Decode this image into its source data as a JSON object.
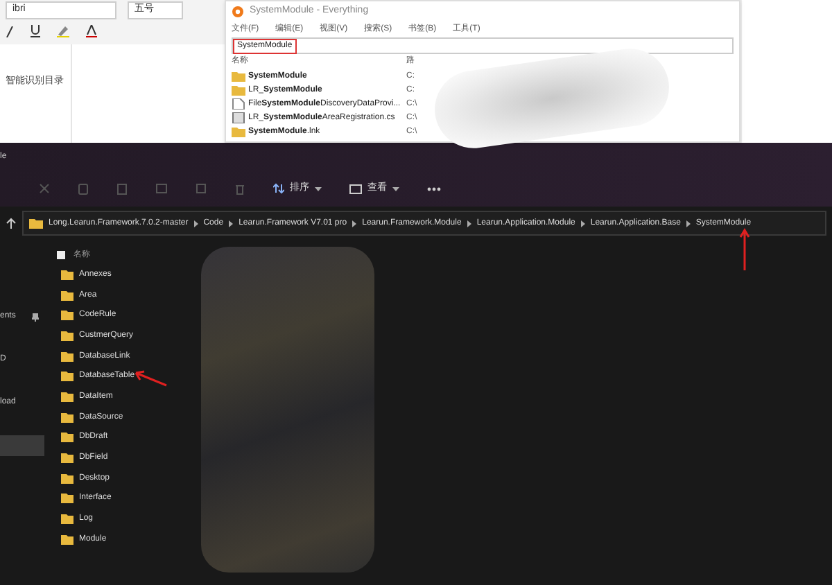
{
  "word_toolbar": {
    "font_name": "ibri",
    "font_size": "五号"
  },
  "word_nav_pane": {
    "title": "智能识别目录"
  },
  "everything_window": {
    "title": "SystemModule - Everything",
    "menu": [
      "文件(F)",
      "编辑(E)",
      "视图(V)",
      "搜索(S)",
      "书签(B)",
      "工具(T)"
    ],
    "search": {
      "value": "SystemModule"
    },
    "columns": [
      "名称",
      "路"
    ],
    "rows": [
      {
        "kind": "folder",
        "name": "**SystemModule**",
        "path": "C:"
      },
      {
        "kind": "folder",
        "name": "LR_**SystemModule**",
        "path": "C:"
      },
      {
        "kind": "file",
        "name": "File**SystemModule**DiscoveryDataProvi...",
        "path": "C:\\"
      },
      {
        "kind": "code",
        "name": "LR_**SystemModule**AreaRegistration.cs",
        "path": "C:\\"
      },
      {
        "kind": "folder",
        "name": "**SystemModule**.lnk",
        "path": "C:\\"
      }
    ]
  },
  "explorer": {
    "title": "le",
    "toolbar": [
      "排序",
      "查看"
    ],
    "breadcrumbs": [
      "Long.Learun.Framework.7.0.2-master",
      "Code",
      "Learun.Framework V7.01 pro",
      "Learun.Framework.Module",
      "Learun.Application.Module",
      "Learun.Application.Base",
      "SystemModule"
    ],
    "nav_items": [
      {
        "label": "ents",
        "pinned": true,
        "selected": false
      },
      {
        "label": "D",
        "pinned": false,
        "selected": false
      },
      {
        "label": "load",
        "pinned": false,
        "selected": false
      },
      {
        "pinned": false,
        "selected": true
      }
    ],
    "select_all": {
      "checked": false
    },
    "column_header": "名称",
    "folders": [
      "Annexes",
      "Area",
      "CodeRule",
      "CustmerQuery",
      "DatabaseLink",
      "DatabaseTable",
      "DataItem",
      "DataSource",
      "DbDraft",
      "DbField",
      "Desktop",
      "Interface",
      "Log",
      "Module"
    ]
  }
}
